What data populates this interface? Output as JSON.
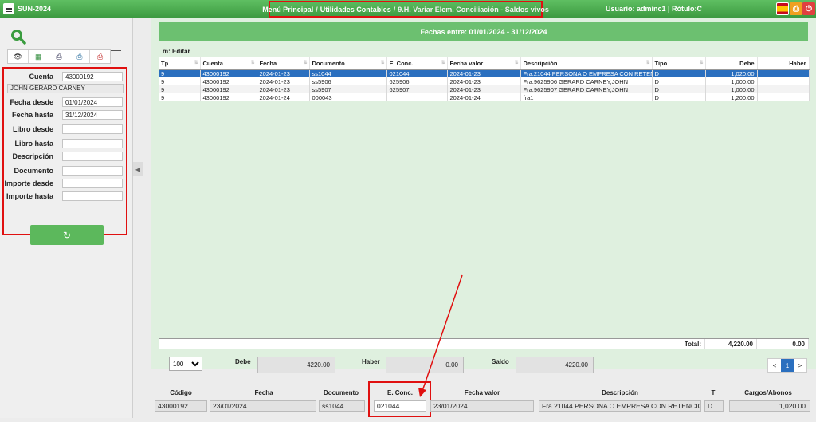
{
  "topbar": {
    "app_title": "SUN-2024",
    "breadcrumb": [
      "Menú Principal",
      "Utilidades Contables",
      "9.H. Variar Elem. Conciliación - Saldos vivos"
    ],
    "user_info": "Usuario: adminc1 | Rótulo:C"
  },
  "filters": {
    "cuenta_label": "Cuenta",
    "cuenta_value": "43000192",
    "client_name": "JOHN GERARD CARNEY",
    "fecha_desde_label": "Fecha desde",
    "fecha_desde_value": "01/01/2024",
    "fecha_hasta_label": "Fecha hasta",
    "fecha_hasta_value": "31/12/2024",
    "libro_desde_label": "Libro desde",
    "libro_hasta_label": "Libro hasta",
    "descripcion_label": "Descripción",
    "documento_label": "Documento",
    "importe_desde_label": "Importe desde",
    "importe_hasta_label": "Importe hasta"
  },
  "main": {
    "date_header": "Fechas entre: 01/01/2024 - 31/12/2024",
    "mode_label": "m: Editar",
    "columns": [
      "Tp",
      "Cuenta",
      "Fecha",
      "Documento",
      "E. Conc.",
      "Fecha valor",
      "Descripción",
      "Tipo",
      "Debe",
      "Haber"
    ],
    "rows": [
      [
        "9",
        "43000192",
        "2024-01-23",
        "ss1044",
        "021044",
        "2024-01-23",
        "Fra.21044 PERSONA O EMPRESA CON RETENCION",
        "D",
        "1,020.00",
        ""
      ],
      [
        "9",
        "43000192",
        "2024-01-23",
        "ss5906",
        "625906",
        "2024-01-23",
        "Fra.9625906 GERARD CARNEY,JOHN",
        "D",
        "1,000.00",
        ""
      ],
      [
        "9",
        "43000192",
        "2024-01-23",
        "ss5907",
        "625907",
        "2024-01-23",
        "Fra.9625907 GERARD CARNEY,JOHN",
        "D",
        "1,000.00",
        ""
      ],
      [
        "9",
        "43000192",
        "2024-01-24",
        "000043",
        "",
        "2024-01-24",
        "fra1",
        "D",
        "1,200.00",
        ""
      ]
    ],
    "total_label": "Total:",
    "total_debe": "4,220.00",
    "total_haber": "0.00"
  },
  "summary": {
    "page_size": "100",
    "debe_label": "Debe",
    "debe_value": "4220.00",
    "haber_label": "Haber",
    "haber_value": "0.00",
    "saldo_label": "Saldo",
    "saldo_value": "4220.00",
    "pager_prev": "<",
    "pager_current": "1",
    "pager_next": ">"
  },
  "detail": {
    "codigo_label": "Código",
    "codigo_value": "43000192",
    "fecha_label": "Fecha",
    "fecha_value": "23/01/2024",
    "documento_label": "Documento",
    "documento_value": "ss1044",
    "econc_label": "E. Conc.",
    "econc_value": "021044",
    "fecha_valor_label": "Fecha valor",
    "fecha_valor_value": "23/01/2024",
    "descripcion_label": "Descripción",
    "descripcion_value": "Fra.21044 PERSONA O EMPRESA CON RETENCION",
    "t_label": "T",
    "t_value": "D",
    "cargos_label": "Cargos/Abonos",
    "cargos_value": "1,020.00"
  },
  "colors": {
    "header_green": "#4caf50",
    "selected_row": "#2a6fbf",
    "highlight_red": "#e01010",
    "panel_bg": "#dff0df"
  },
  "icons": [
    "menu-icon",
    "search-icon",
    "eye-icon",
    "excel-icon",
    "print-icon",
    "printer-alt-icon",
    "pdf-icon",
    "refresh-icon",
    "flag-icon",
    "power-icon",
    "chevron-left-icon"
  ]
}
